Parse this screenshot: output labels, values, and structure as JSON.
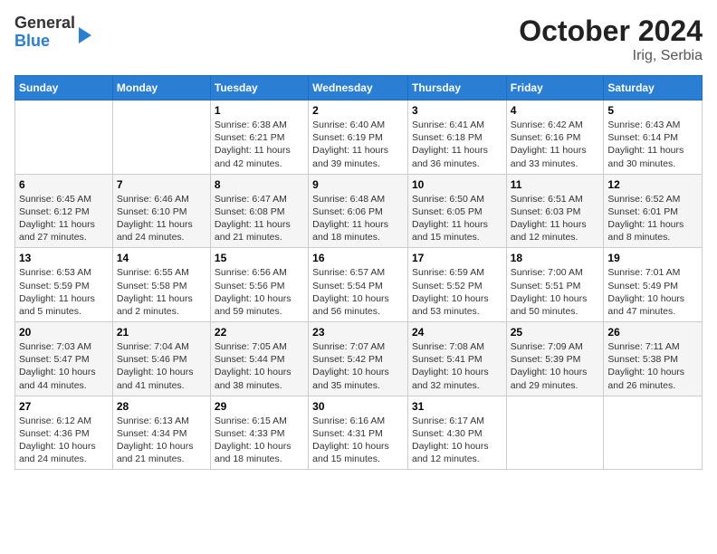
{
  "header": {
    "logo_general": "General",
    "logo_blue": "Blue",
    "title": "October 2024",
    "subtitle": "Irig, Serbia"
  },
  "days_of_week": [
    "Sunday",
    "Monday",
    "Tuesday",
    "Wednesday",
    "Thursday",
    "Friday",
    "Saturday"
  ],
  "weeks": [
    [
      {
        "day": "",
        "sunrise": "",
        "sunset": "",
        "daylight": ""
      },
      {
        "day": "",
        "sunrise": "",
        "sunset": "",
        "daylight": ""
      },
      {
        "day": "1",
        "sunrise": "Sunrise: 6:38 AM",
        "sunset": "Sunset: 6:21 PM",
        "daylight": "Daylight: 11 hours and 42 minutes."
      },
      {
        "day": "2",
        "sunrise": "Sunrise: 6:40 AM",
        "sunset": "Sunset: 6:19 PM",
        "daylight": "Daylight: 11 hours and 39 minutes."
      },
      {
        "day": "3",
        "sunrise": "Sunrise: 6:41 AM",
        "sunset": "Sunset: 6:18 PM",
        "daylight": "Daylight: 11 hours and 36 minutes."
      },
      {
        "day": "4",
        "sunrise": "Sunrise: 6:42 AM",
        "sunset": "Sunset: 6:16 PM",
        "daylight": "Daylight: 11 hours and 33 minutes."
      },
      {
        "day": "5",
        "sunrise": "Sunrise: 6:43 AM",
        "sunset": "Sunset: 6:14 PM",
        "daylight": "Daylight: 11 hours and 30 minutes."
      }
    ],
    [
      {
        "day": "6",
        "sunrise": "Sunrise: 6:45 AM",
        "sunset": "Sunset: 6:12 PM",
        "daylight": "Daylight: 11 hours and 27 minutes."
      },
      {
        "day": "7",
        "sunrise": "Sunrise: 6:46 AM",
        "sunset": "Sunset: 6:10 PM",
        "daylight": "Daylight: 11 hours and 24 minutes."
      },
      {
        "day": "8",
        "sunrise": "Sunrise: 6:47 AM",
        "sunset": "Sunset: 6:08 PM",
        "daylight": "Daylight: 11 hours and 21 minutes."
      },
      {
        "day": "9",
        "sunrise": "Sunrise: 6:48 AM",
        "sunset": "Sunset: 6:06 PM",
        "daylight": "Daylight: 11 hours and 18 minutes."
      },
      {
        "day": "10",
        "sunrise": "Sunrise: 6:50 AM",
        "sunset": "Sunset: 6:05 PM",
        "daylight": "Daylight: 11 hours and 15 minutes."
      },
      {
        "day": "11",
        "sunrise": "Sunrise: 6:51 AM",
        "sunset": "Sunset: 6:03 PM",
        "daylight": "Daylight: 11 hours and 12 minutes."
      },
      {
        "day": "12",
        "sunrise": "Sunrise: 6:52 AM",
        "sunset": "Sunset: 6:01 PM",
        "daylight": "Daylight: 11 hours and 8 minutes."
      }
    ],
    [
      {
        "day": "13",
        "sunrise": "Sunrise: 6:53 AM",
        "sunset": "Sunset: 5:59 PM",
        "daylight": "Daylight: 11 hours and 5 minutes."
      },
      {
        "day": "14",
        "sunrise": "Sunrise: 6:55 AM",
        "sunset": "Sunset: 5:58 PM",
        "daylight": "Daylight: 11 hours and 2 minutes."
      },
      {
        "day": "15",
        "sunrise": "Sunrise: 6:56 AM",
        "sunset": "Sunset: 5:56 PM",
        "daylight": "Daylight: 10 hours and 59 minutes."
      },
      {
        "day": "16",
        "sunrise": "Sunrise: 6:57 AM",
        "sunset": "Sunset: 5:54 PM",
        "daylight": "Daylight: 10 hours and 56 minutes."
      },
      {
        "day": "17",
        "sunrise": "Sunrise: 6:59 AM",
        "sunset": "Sunset: 5:52 PM",
        "daylight": "Daylight: 10 hours and 53 minutes."
      },
      {
        "day": "18",
        "sunrise": "Sunrise: 7:00 AM",
        "sunset": "Sunset: 5:51 PM",
        "daylight": "Daylight: 10 hours and 50 minutes."
      },
      {
        "day": "19",
        "sunrise": "Sunrise: 7:01 AM",
        "sunset": "Sunset: 5:49 PM",
        "daylight": "Daylight: 10 hours and 47 minutes."
      }
    ],
    [
      {
        "day": "20",
        "sunrise": "Sunrise: 7:03 AM",
        "sunset": "Sunset: 5:47 PM",
        "daylight": "Daylight: 10 hours and 44 minutes."
      },
      {
        "day": "21",
        "sunrise": "Sunrise: 7:04 AM",
        "sunset": "Sunset: 5:46 PM",
        "daylight": "Daylight: 10 hours and 41 minutes."
      },
      {
        "day": "22",
        "sunrise": "Sunrise: 7:05 AM",
        "sunset": "Sunset: 5:44 PM",
        "daylight": "Daylight: 10 hours and 38 minutes."
      },
      {
        "day": "23",
        "sunrise": "Sunrise: 7:07 AM",
        "sunset": "Sunset: 5:42 PM",
        "daylight": "Daylight: 10 hours and 35 minutes."
      },
      {
        "day": "24",
        "sunrise": "Sunrise: 7:08 AM",
        "sunset": "Sunset: 5:41 PM",
        "daylight": "Daylight: 10 hours and 32 minutes."
      },
      {
        "day": "25",
        "sunrise": "Sunrise: 7:09 AM",
        "sunset": "Sunset: 5:39 PM",
        "daylight": "Daylight: 10 hours and 29 minutes."
      },
      {
        "day": "26",
        "sunrise": "Sunrise: 7:11 AM",
        "sunset": "Sunset: 5:38 PM",
        "daylight": "Daylight: 10 hours and 26 minutes."
      }
    ],
    [
      {
        "day": "27",
        "sunrise": "Sunrise: 6:12 AM",
        "sunset": "Sunset: 4:36 PM",
        "daylight": "Daylight: 10 hours and 24 minutes."
      },
      {
        "day": "28",
        "sunrise": "Sunrise: 6:13 AM",
        "sunset": "Sunset: 4:34 PM",
        "daylight": "Daylight: 10 hours and 21 minutes."
      },
      {
        "day": "29",
        "sunrise": "Sunrise: 6:15 AM",
        "sunset": "Sunset: 4:33 PM",
        "daylight": "Daylight: 10 hours and 18 minutes."
      },
      {
        "day": "30",
        "sunrise": "Sunrise: 6:16 AM",
        "sunset": "Sunset: 4:31 PM",
        "daylight": "Daylight: 10 hours and 15 minutes."
      },
      {
        "day": "31",
        "sunrise": "Sunrise: 6:17 AM",
        "sunset": "Sunset: 4:30 PM",
        "daylight": "Daylight: 10 hours and 12 minutes."
      },
      {
        "day": "",
        "sunrise": "",
        "sunset": "",
        "daylight": ""
      },
      {
        "day": "",
        "sunrise": "",
        "sunset": "",
        "daylight": ""
      }
    ]
  ]
}
